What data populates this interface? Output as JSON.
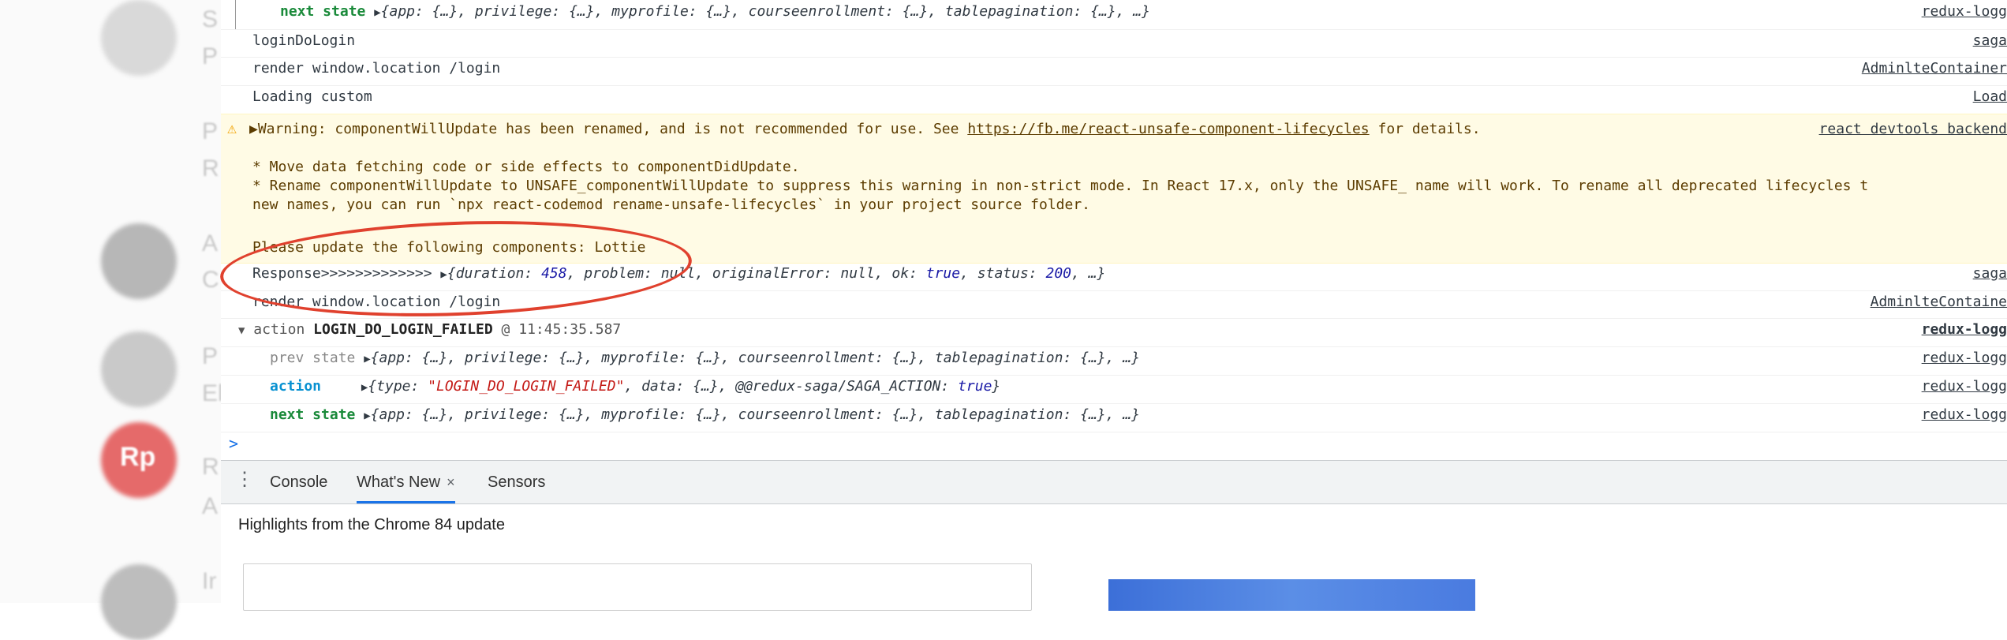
{
  "background": {
    "letters": [
      "S",
      "P",
      "P",
      "R",
      "A",
      "C",
      "P",
      "El",
      "R",
      "A",
      "Ir"
    ],
    "avatars": [
      {
        "color": "#d9d9d9"
      },
      {
        "color": "#b7b7b7"
      },
      {
        "color": "#c9c9c9"
      },
      {
        "color": "#e56a6a"
      },
      {
        "color": "#bdbdbd"
      }
    ],
    "rp_badge": "Rp"
  },
  "console": {
    "rows": [
      {
        "kind": "state",
        "label": "next state",
        "value": "{app: {…}, privilege: {…}, myprofile: {…}, courseenrollment: {…}, tablepagination: {…}, …}",
        "source": "redux-logg"
      },
      {
        "kind": "plain",
        "text": "loginDoLogin",
        "source": "saga"
      },
      {
        "kind": "plain",
        "text": "render window.location  /login",
        "source": "AdminlteContainer"
      },
      {
        "kind": "plain",
        "text": "Loading custom",
        "source": "Load"
      }
    ],
    "warning": {
      "icon": "warning-icon",
      "head_prefix": "▶Warning: componentWillUpdate has been renamed, and is not recommended for use. See ",
      "link": "https://fb.me/react-unsafe-component-lifecycles",
      "head_suffix": " for details.",
      "source": "react devtools backend",
      "bullet1": "* Move data fetching code or side effects to componentDidUpdate.",
      "bullet2": "* Rename componentWillUpdate to UNSAFE_componentWillUpdate to suppress this warning in non-strict mode. In React 17.x, only the UNSAFE_ name will work. To rename all deprecated lifecycles t",
      "bullet2b": "new names, you can run `npx react-codemod rename-unsafe-lifecycles` in your project source folder.",
      "footer": "Please update the following components: Lottie"
    },
    "response": {
      "label": "Response>>>>>>>>>>>>> ",
      "pre": "{duration: ",
      "duration": "458",
      "mid": ", problem: null, originalError: null, ok: ",
      "ok": "true",
      "mid2": ", status: ",
      "status": "200",
      "post": ", …}",
      "source": "saga"
    },
    "render2": {
      "text": "render window.location  /login",
      "source": "AdminlteContaine"
    },
    "group": {
      "prefix": "▼",
      "action_word": "action ",
      "action_name": "LOGIN_DO_LOGIN_FAILED",
      "time": " @ 11:45:35.587",
      "source": "redux-logg"
    },
    "prev_state": {
      "label": "prev state",
      "value": "{app: {…}, privilege: {…}, myprofile: {…}, courseenrollment: {…}, tablepagination: {…}, …}",
      "source": "redux-logg"
    },
    "action": {
      "label": "action",
      "pre": "{type: ",
      "type": "\"LOGIN_DO_LOGIN_FAILED\"",
      "mid": ", data: {…}, @@redux-saga/SAGA_ACTION: ",
      "flag": "true",
      "post": "}",
      "source": "redux-logg"
    },
    "next_state2": {
      "label": "next state",
      "value": "{app: {…}, privilege: {…}, myprofile: {…}, courseenrollment: {…}, tablepagination: {…}, …}",
      "source": "redux-logg"
    },
    "prompt": ">"
  },
  "drawer": {
    "tabs": [
      {
        "label": "Console"
      },
      {
        "label": "What's New",
        "close": "×"
      },
      {
        "label": "Sensors"
      }
    ],
    "highlights": "Highlights from the Chrome 84 update"
  },
  "colors": {
    "accent": "#1a73e8",
    "annotation": "#e0412e",
    "warning_bg": "#fffbe5"
  }
}
